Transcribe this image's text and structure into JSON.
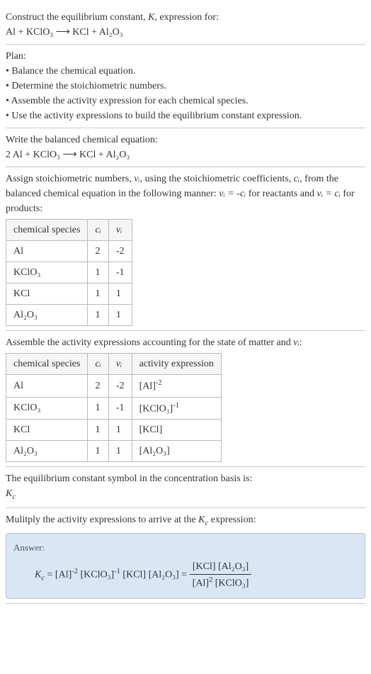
{
  "intro": {
    "line1": "Construct the equilibrium constant, ",
    "K": "K",
    "line1b": ", expression for:",
    "equation": "Al + KClO₃  ⟶  KCl + Al₂O₃"
  },
  "plan": {
    "heading": "Plan:",
    "b1": "• Balance the chemical equation.",
    "b2": "• Determine the stoichiometric numbers.",
    "b3": "• Assemble the activity expression for each chemical species.",
    "b4": "• Use the activity expressions to build the equilibrium constant expression."
  },
  "balanced": {
    "heading": "Write the balanced chemical equation:",
    "equation": "2 Al + KClO₃  ⟶  KCl + Al₂O₃"
  },
  "stoich": {
    "text1": "Assign stoichiometric numbers, ",
    "nu_i": "νᵢ",
    "text2": ", using the stoichiometric coefficients, ",
    "c_i": "cᵢ",
    "text3": ", from the balanced chemical equation in the following manner: ",
    "rel1": "νᵢ = -cᵢ",
    "text4": " for reactants and ",
    "rel2": "νᵢ = cᵢ",
    "text5": " for products:",
    "headers": [
      "chemical species",
      "cᵢ",
      "νᵢ"
    ],
    "rows": [
      [
        "Al",
        "2",
        "-2"
      ],
      [
        "KClO₃",
        "1",
        "-1"
      ],
      [
        "KCl",
        "1",
        "1"
      ],
      [
        "Al₂O₃",
        "1",
        "1"
      ]
    ]
  },
  "activity": {
    "heading": "Assemble the activity expressions accounting for the state of matter and ",
    "nu_i": "νᵢ",
    "colon": ":",
    "headers": [
      "chemical species",
      "cᵢ",
      "νᵢ",
      "activity expression"
    ],
    "rows": [
      {
        "sp": "Al",
        "c": "2",
        "nu": "-2",
        "act_base": "[Al]",
        "act_exp": "-2"
      },
      {
        "sp": "KClO₃",
        "c": "1",
        "nu": "-1",
        "act_base": "[KClO₃]",
        "act_exp": "-1"
      },
      {
        "sp": "KCl",
        "c": "1",
        "nu": "1",
        "act_base": "[KCl]",
        "act_exp": ""
      },
      {
        "sp": "Al₂O₃",
        "c": "1",
        "nu": "1",
        "act_base": "[Al₂O₃]",
        "act_exp": ""
      }
    ]
  },
  "symbol": {
    "text": "The equilibrium constant symbol in the concentration basis is:",
    "kc": "K",
    "kc_sub": "c"
  },
  "final": {
    "heading": "Mulitply the activity expressions to arrive at the ",
    "kc": "K",
    "kc_sub": "c",
    "heading2": " expression:",
    "answer_label": "Answer:",
    "lhs_k": "K",
    "lhs_sub": "c",
    "eq": " = ",
    "t1": "[Al]",
    "e1": "-2",
    "t2": " [KClO₃]",
    "e2": "-1",
    "t3": " [KCl] [Al₂O₃] = ",
    "num": "[KCl] [Al₂O₃]",
    "den_a": "[Al]",
    "den_a_exp": "2",
    "den_b": " [KClO₃]"
  }
}
